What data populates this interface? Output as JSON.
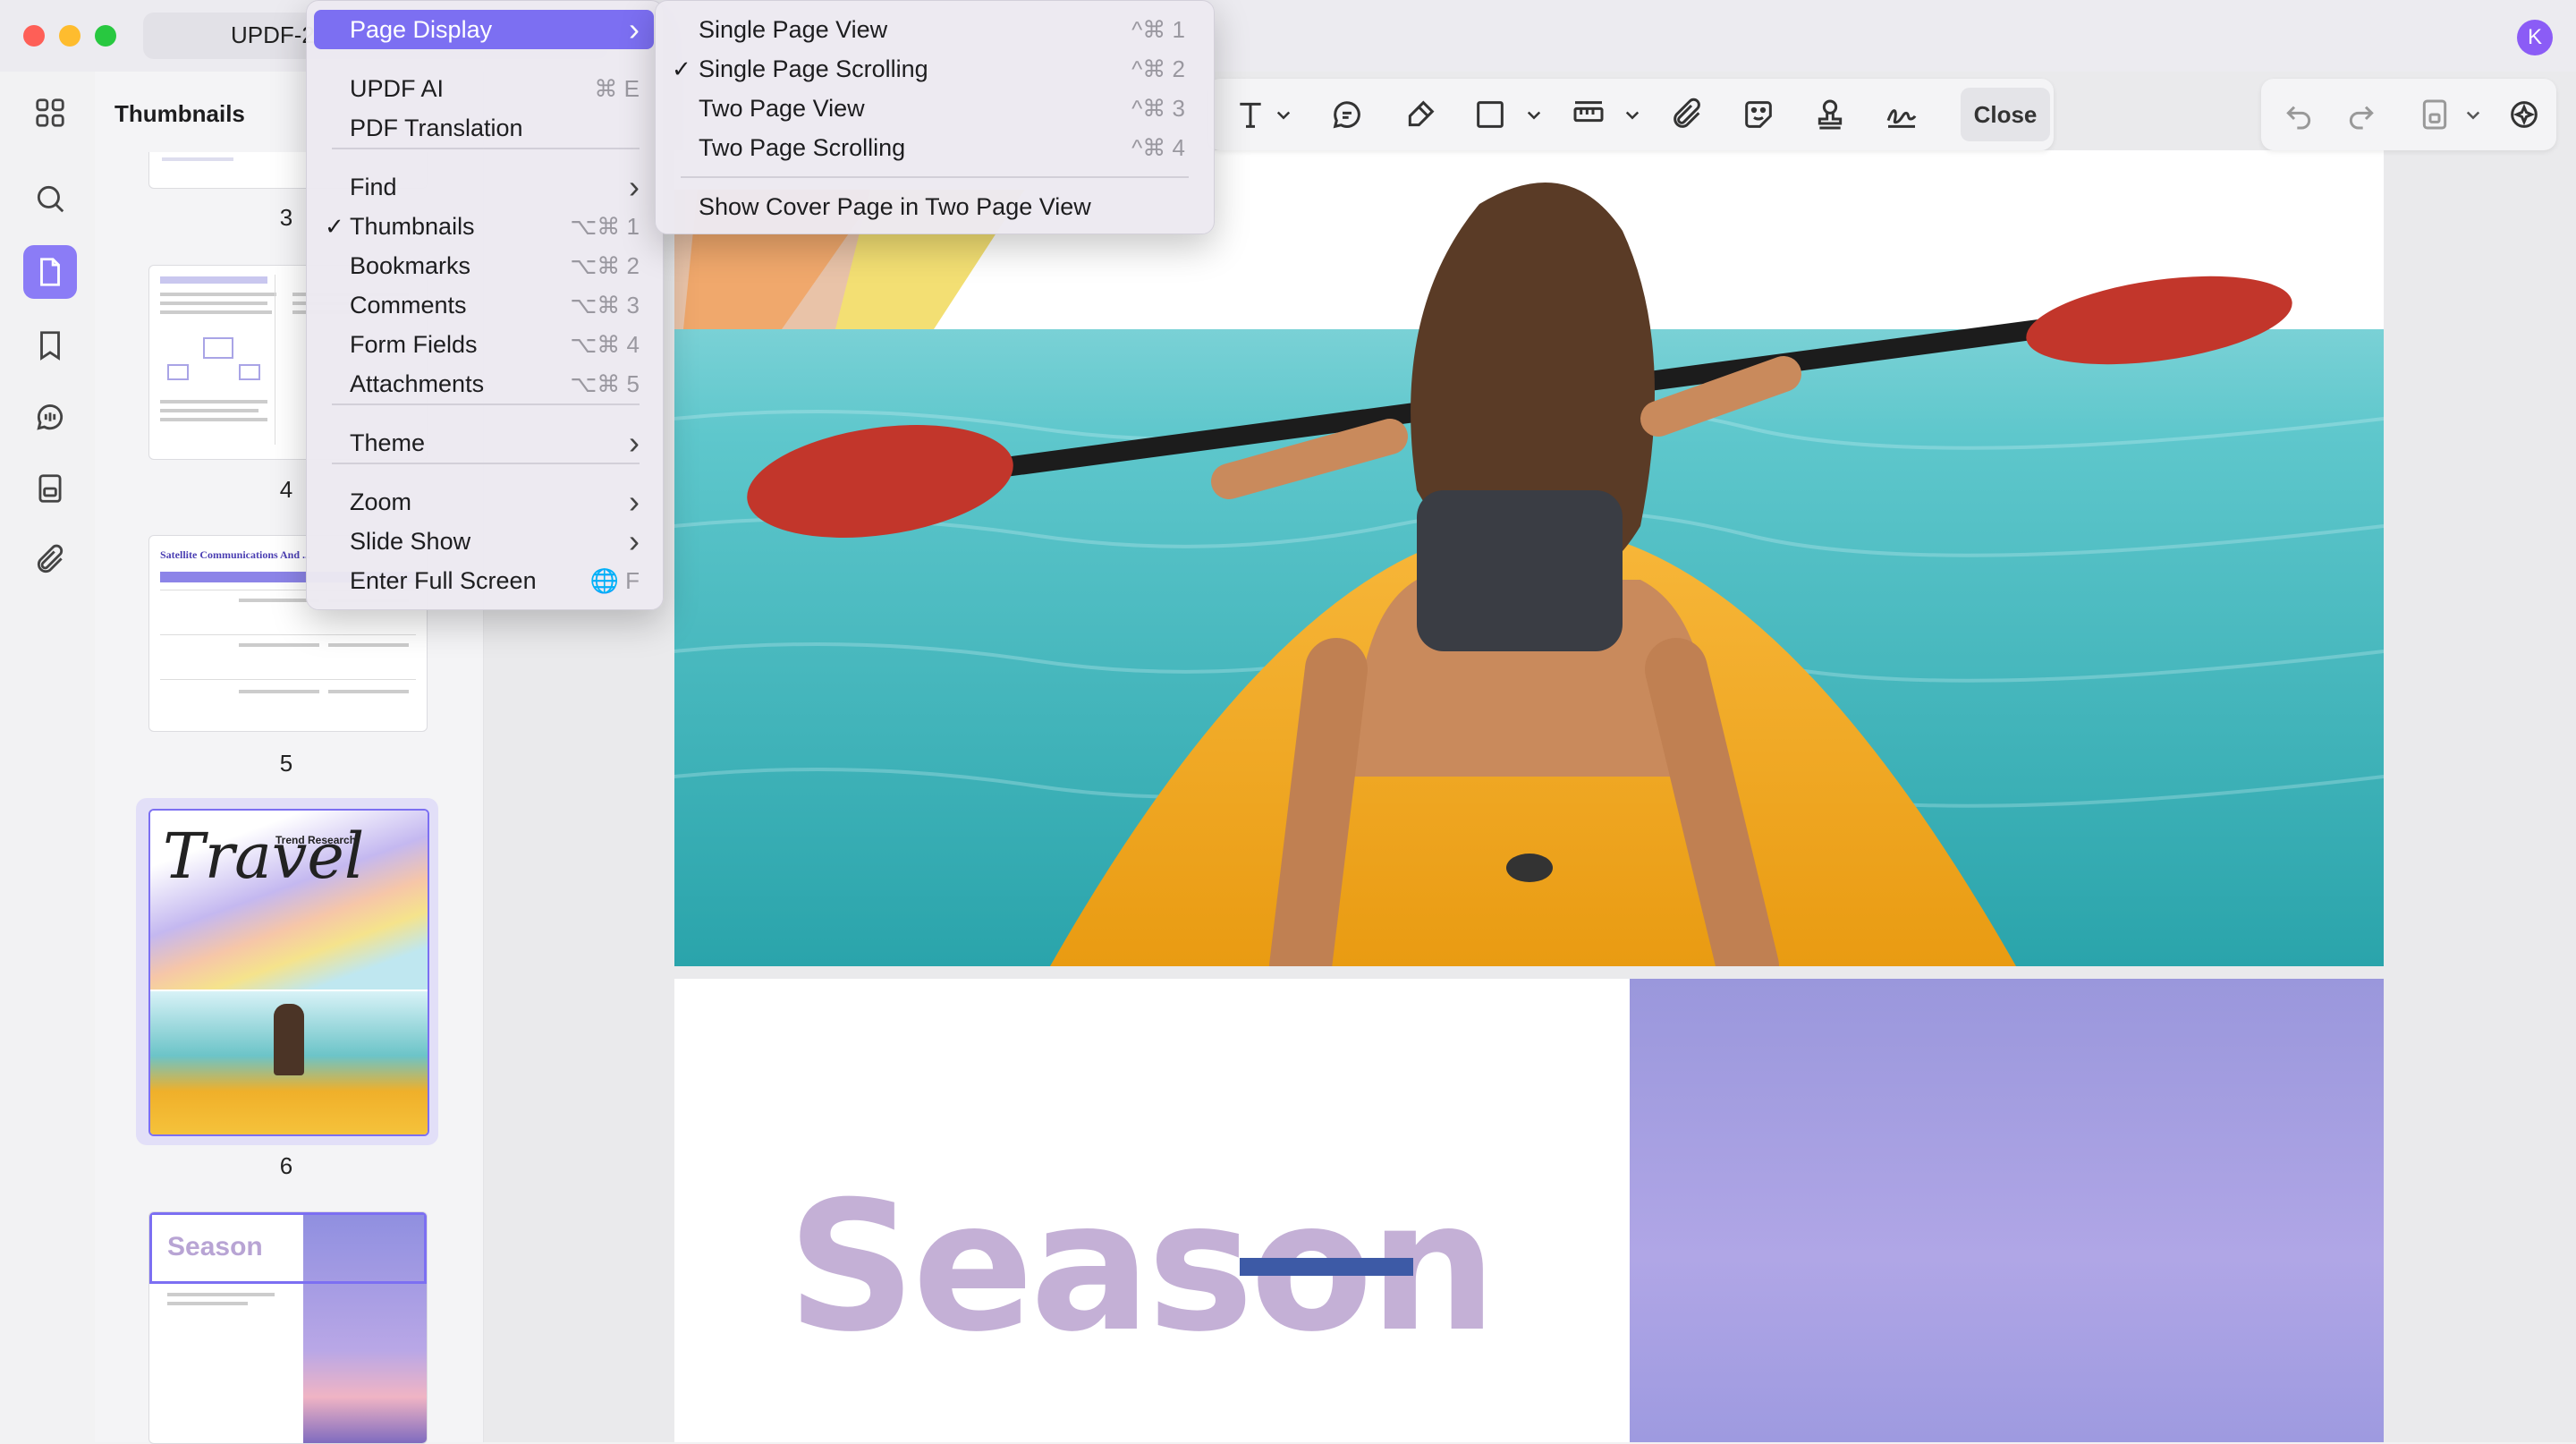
{
  "window": {
    "tab_title": "UPDF-2",
    "avatar_letter": "K"
  },
  "sidebar": {
    "title": "Thumbnails",
    "pages": [
      "3",
      "4",
      "5",
      "6"
    ],
    "thumb_texts": {
      "satellite": "Satellite Communications And ...",
      "travel": "Travel",
      "trend": "Trend Research",
      "season": "Season"
    }
  },
  "toolbar": {
    "close_label": "Close"
  },
  "document": {
    "season_text": "Season"
  },
  "view_menu": {
    "items": [
      {
        "label": "Page Display",
        "shortcut": "",
        "submenu": true,
        "checked": false,
        "highlighted": true
      },
      {
        "label": "UPDF AI",
        "shortcut": "⌘ E",
        "submenu": false,
        "checked": false
      },
      {
        "label": "PDF Translation",
        "shortcut": "",
        "submenu": false,
        "checked": false
      },
      {
        "label": "Find",
        "shortcut": "",
        "submenu": true,
        "checked": false
      },
      {
        "label": "Thumbnails",
        "shortcut": "⌥⌘ 1",
        "submenu": false,
        "checked": true
      },
      {
        "label": "Bookmarks",
        "shortcut": "⌥⌘ 2",
        "submenu": false,
        "checked": false
      },
      {
        "label": "Comments",
        "shortcut": "⌥⌘ 3",
        "submenu": false,
        "checked": false
      },
      {
        "label": "Form Fields",
        "shortcut": "⌥⌘ 4",
        "submenu": false,
        "checked": false
      },
      {
        "label": "Attachments",
        "shortcut": "⌥⌘ 5",
        "submenu": false,
        "checked": false
      },
      {
        "label": "Theme",
        "shortcut": "",
        "submenu": true,
        "checked": false
      },
      {
        "label": "Zoom",
        "shortcut": "",
        "submenu": true,
        "checked": false
      },
      {
        "label": "Slide Show",
        "shortcut": "",
        "submenu": true,
        "checked": false
      },
      {
        "label": "Enter Full Screen",
        "shortcut": "🌐 F",
        "submenu": false,
        "checked": false
      }
    ]
  },
  "page_display_menu": {
    "items": [
      {
        "label": "Single Page View",
        "shortcut": "^⌘ 1",
        "checked": false
      },
      {
        "label": "Single Page Scrolling",
        "shortcut": "^⌘ 2",
        "checked": true
      },
      {
        "label": "Two Page View",
        "shortcut": "^⌘ 3",
        "checked": false
      },
      {
        "label": "Two Page Scrolling",
        "shortcut": "^⌘ 4",
        "checked": false
      },
      {
        "label": "Show Cover Page in Two Page View",
        "shortcut": "",
        "checked": false
      }
    ]
  },
  "colors": {
    "accent": "#7c6ff2",
    "rail_active": "#8b7cf6"
  }
}
